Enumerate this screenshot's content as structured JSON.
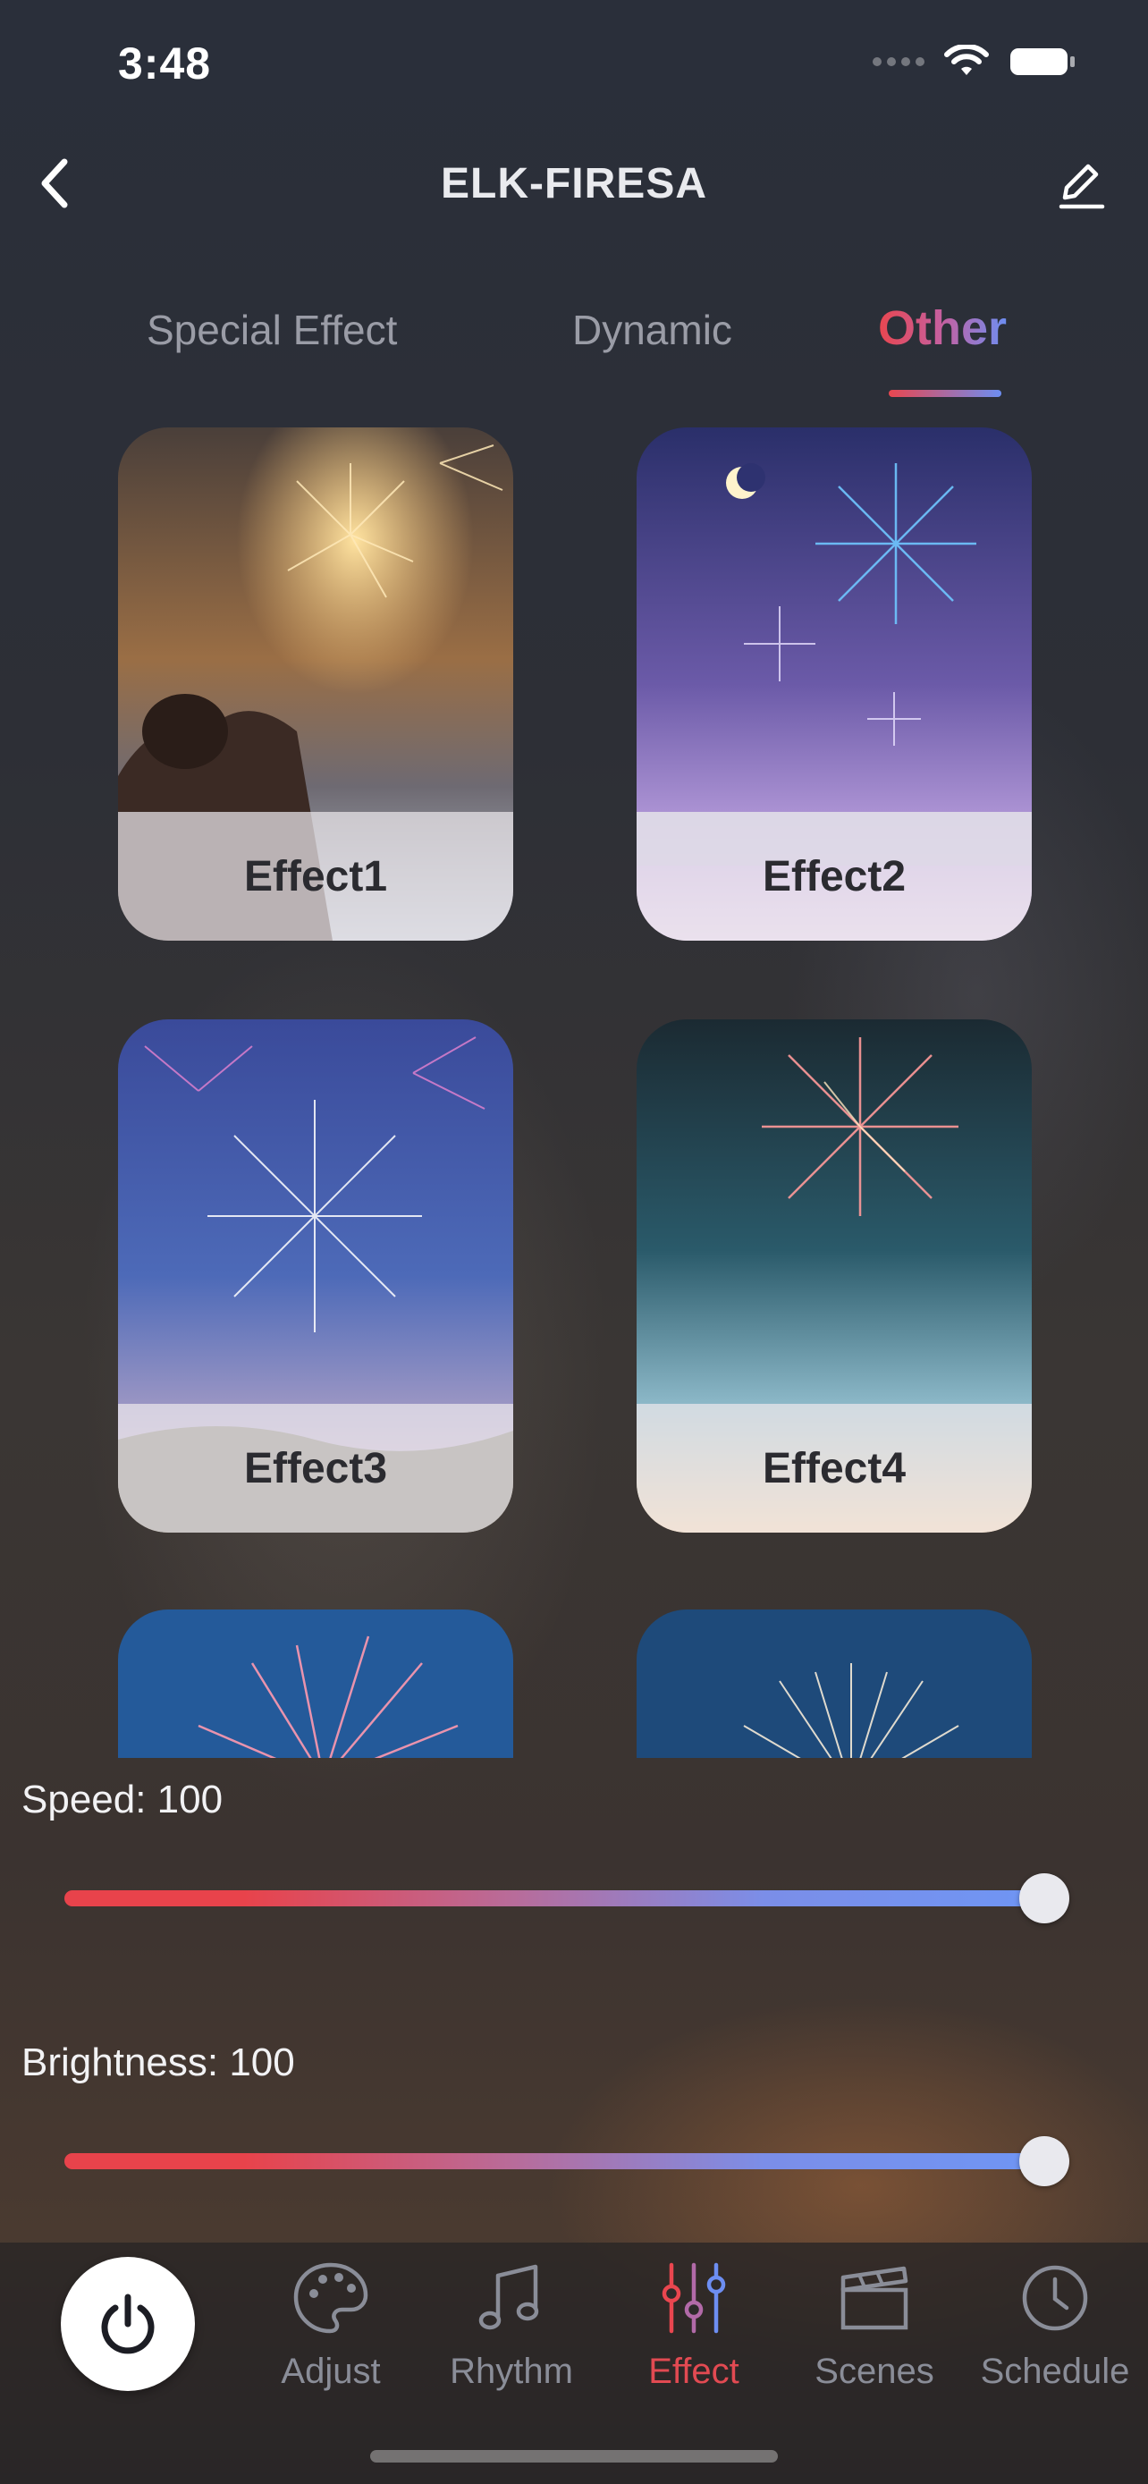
{
  "status_bar": {
    "time": "3:48"
  },
  "header": {
    "title": "ELK-FIRESA"
  },
  "tabs": [
    {
      "label": "Special Effect",
      "active": false
    },
    {
      "label": "Dynamic",
      "active": false
    },
    {
      "label": "Other",
      "active": true
    }
  ],
  "effects": [
    {
      "label": "Effect1"
    },
    {
      "label": "Effect2"
    },
    {
      "label": "Effect3"
    },
    {
      "label": "Effect4"
    },
    {
      "label": ""
    },
    {
      "label": ""
    }
  ],
  "speed": {
    "label": "Speed: 100",
    "value": 100,
    "max": 100
  },
  "brightness": {
    "label": "Brightness: 100",
    "value": 100,
    "max": 100
  },
  "nav": {
    "items": [
      {
        "label": "Adjust",
        "icon": "palette-icon",
        "active": false
      },
      {
        "label": "Rhythm",
        "icon": "music-note-icon",
        "active": false
      },
      {
        "label": "Effect",
        "icon": "sliders-icon",
        "active": true
      },
      {
        "label": "Scenes",
        "icon": "clapperboard-icon",
        "active": false
      },
      {
        "label": "Schedule",
        "icon": "clock-icon",
        "active": false
      }
    ]
  },
  "colors": {
    "accent_red": "#e9464f",
    "accent_blue": "#6d8ef2",
    "inactive_gray": "#8a8d98"
  }
}
